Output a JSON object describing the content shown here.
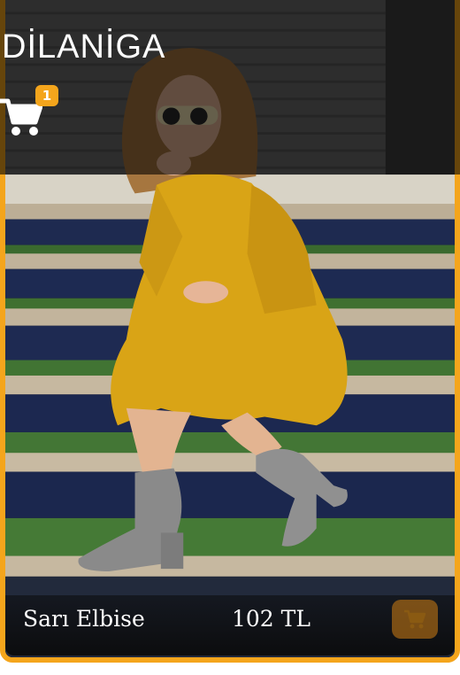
{
  "header": {
    "brand": "DİLANİGA",
    "cart_count": "1"
  },
  "product": {
    "name": "Sarı Elbise",
    "price": "102 TL",
    "image_alt": "Woman in a yellow knit dress and grey ankle boots sitting on outdoor steps"
  },
  "icons": {
    "cart": "shopping-cart-icon",
    "add_to_cart": "shopping-cart-icon"
  },
  "colors": {
    "accent": "#f4a51c",
    "dress": "#d9a416"
  }
}
